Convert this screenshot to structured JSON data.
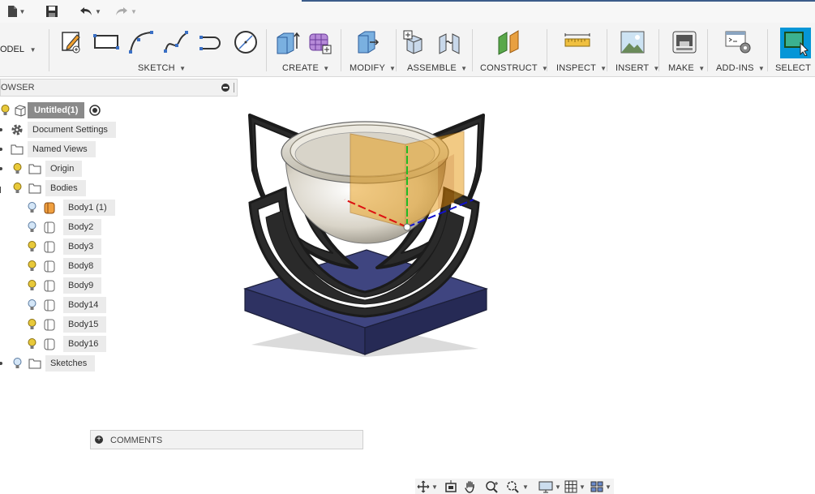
{
  "toolbar": {
    "workspace_label": "ODEL",
    "groups": [
      {
        "label": "SKETCH"
      },
      {
        "label": "CREATE"
      },
      {
        "label": "MODIFY"
      },
      {
        "label": "ASSEMBLE"
      },
      {
        "label": "CONSTRUCT"
      },
      {
        "label": "INSPECT"
      },
      {
        "label": "INSERT"
      },
      {
        "label": "MAKE"
      },
      {
        "label": "ADD-INS"
      },
      {
        "label": "SELECT"
      }
    ]
  },
  "browser": {
    "title": "OWSER",
    "root": "Untitled(1)",
    "items": [
      {
        "label": "Document Settings",
        "icon": "gear-icon"
      },
      {
        "label": "Named Views",
        "icon": "folder-icon"
      },
      {
        "label": "Origin",
        "icon": "folder-icon"
      },
      {
        "label": "Bodies",
        "icon": "folder-icon"
      },
      {
        "label": "Sketches",
        "icon": "folder-icon"
      }
    ],
    "bodies": [
      {
        "label": "Body1 (1)"
      },
      {
        "label": "Body2"
      },
      {
        "label": "Body3"
      },
      {
        "label": "Body8"
      },
      {
        "label": "Body9"
      },
      {
        "label": "Body14"
      },
      {
        "label": "Body15"
      },
      {
        "label": "Body16"
      }
    ]
  },
  "comments": {
    "label": "COMMENTS"
  },
  "colors": {
    "accent": "#0696d7",
    "bulb_on": "#e8c93a",
    "bulb_off": "#9fc3e8",
    "base_plate": "#3a3f7a",
    "frame": "#1c1c1c",
    "construct_plane": "#e8a020"
  }
}
